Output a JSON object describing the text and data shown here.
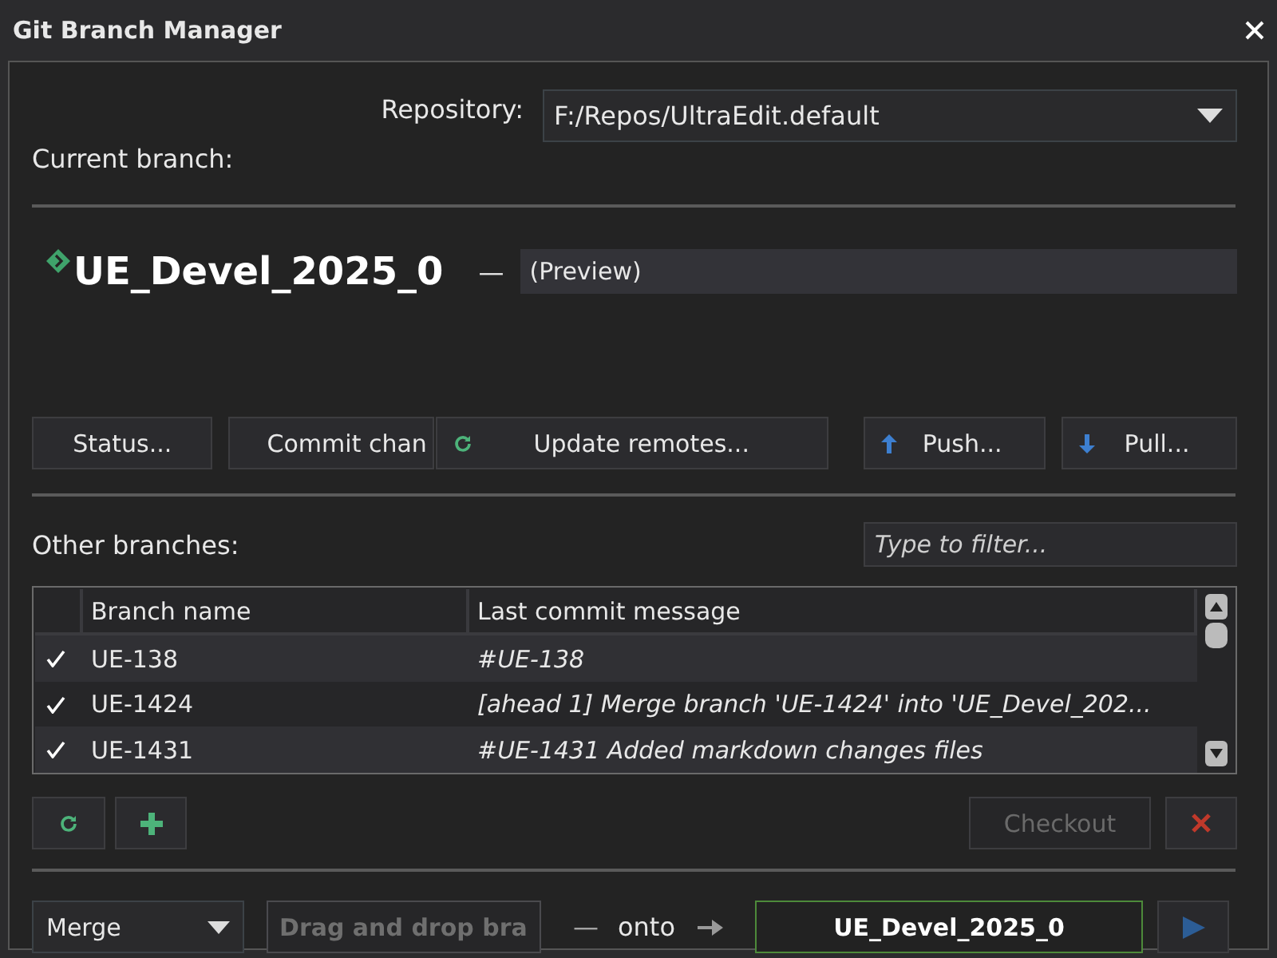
{
  "window": {
    "title": "Git Branch Manager"
  },
  "repository": {
    "label": "Repository:",
    "value": "F:/Repos/UltraEdit.default"
  },
  "current": {
    "label": "Current branch:",
    "branch": "UE_Devel_2025_0",
    "dash": "—",
    "description": "(Preview)"
  },
  "actions": [
    {
      "kind": "text",
      "label": "Status..."
    },
    {
      "kind": "text",
      "label": "Commit chan"
    },
    {
      "kind": "refresh",
      "label": "Update remotes..."
    },
    {
      "kind": "up",
      "label": "Push..."
    },
    {
      "kind": "down",
      "label": "Pull..."
    }
  ],
  "other_branches": {
    "label": "Other branches:",
    "filter_placeholder": "Type to filter..."
  },
  "table": {
    "columns": [
      "Branch name",
      "Last commit message"
    ],
    "rows": [
      {
        "checked": true,
        "name": "UE-138",
        "message": "#UE-138"
      },
      {
        "checked": true,
        "name": "UE-1424",
        "message": "[ahead 1] Merge branch 'UE-1424' into 'UE_Devel_202..."
      },
      {
        "checked": true,
        "name": "UE-1431",
        "message": "#UE-1431 Added markdown changes files"
      }
    ]
  },
  "branch_buttons": [
    {
      "kind": "refresh",
      "disabled": false
    },
    {
      "kind": "add",
      "disabled": false
    },
    {
      "kind": "text",
      "label": "Checkout",
      "disabled": true
    },
    {
      "kind": "delete",
      "disabled": false
    }
  ],
  "merge": {
    "mode": "Merge",
    "source_placeholder": "Drag and drop bra",
    "dash": "—",
    "onto": "onto",
    "target": "UE_Devel_2025_0"
  }
}
